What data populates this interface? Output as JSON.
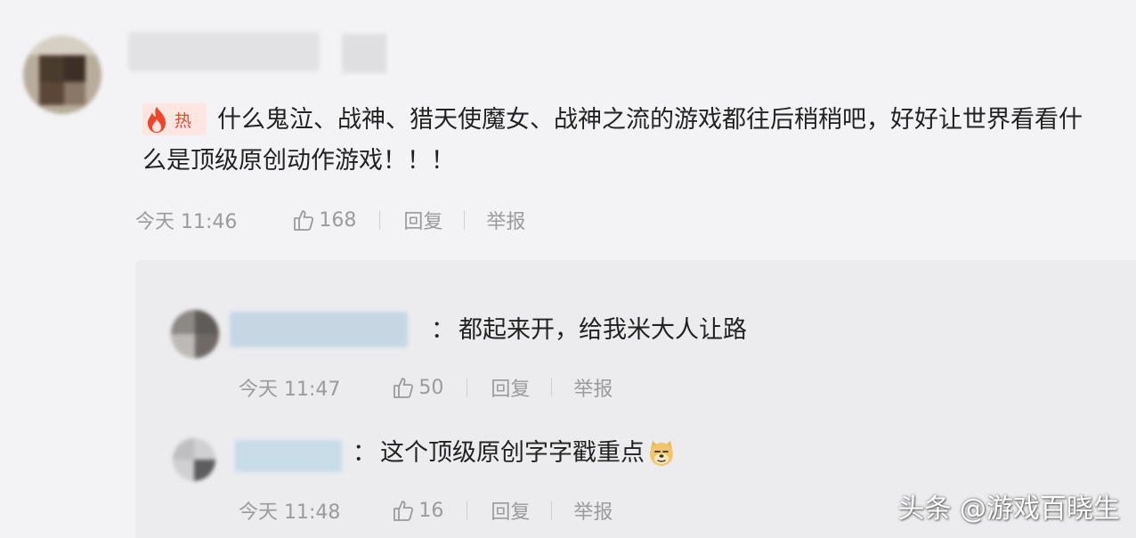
{
  "main_comment": {
    "badge": {
      "icon": "flame-icon",
      "label": "热",
      "color": "#f0452b"
    },
    "text_line1": "什么鬼泣、战神、猎天使魔女、战神之流的游戏都往后稍稍吧，好好让世界看看什",
    "text_line2": "么是顶级原创动作游戏！！！",
    "time": "今天 11:46",
    "likes": "168",
    "reply_label": "回复",
    "report_label": "举报"
  },
  "replies": [
    {
      "colon": "：",
      "text": "都起来开，给我米大人让路",
      "time": "今天 11:47",
      "likes": "50",
      "reply_label": "回复",
      "report_label": "举报"
    },
    {
      "colon": "：",
      "text": "这个顶级原创字字戳重点",
      "emoji": "doge-emoji",
      "time": "今天 11:48",
      "likes": "16",
      "reply_label": "回复",
      "report_label": "举报"
    }
  ],
  "watermark": "头条 @游戏百晓生",
  "colors": {
    "accent_hot": "#f0452b",
    "meta_gray": "#9a9a9f",
    "panel_bg": "#ececee"
  }
}
